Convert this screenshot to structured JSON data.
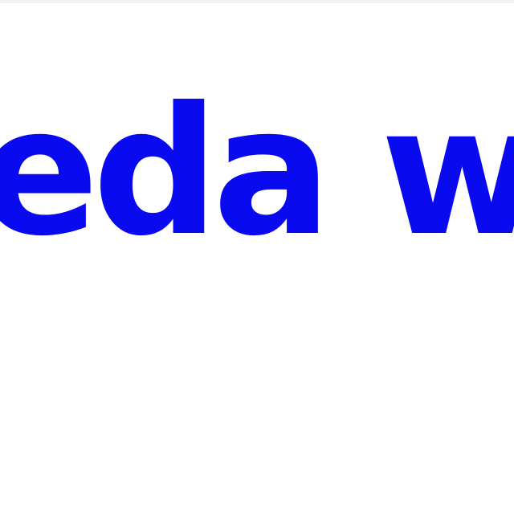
{
  "banner": {
    "text": "eda wo",
    "color": "#0a0af0"
  },
  "background": "#ffffff"
}
